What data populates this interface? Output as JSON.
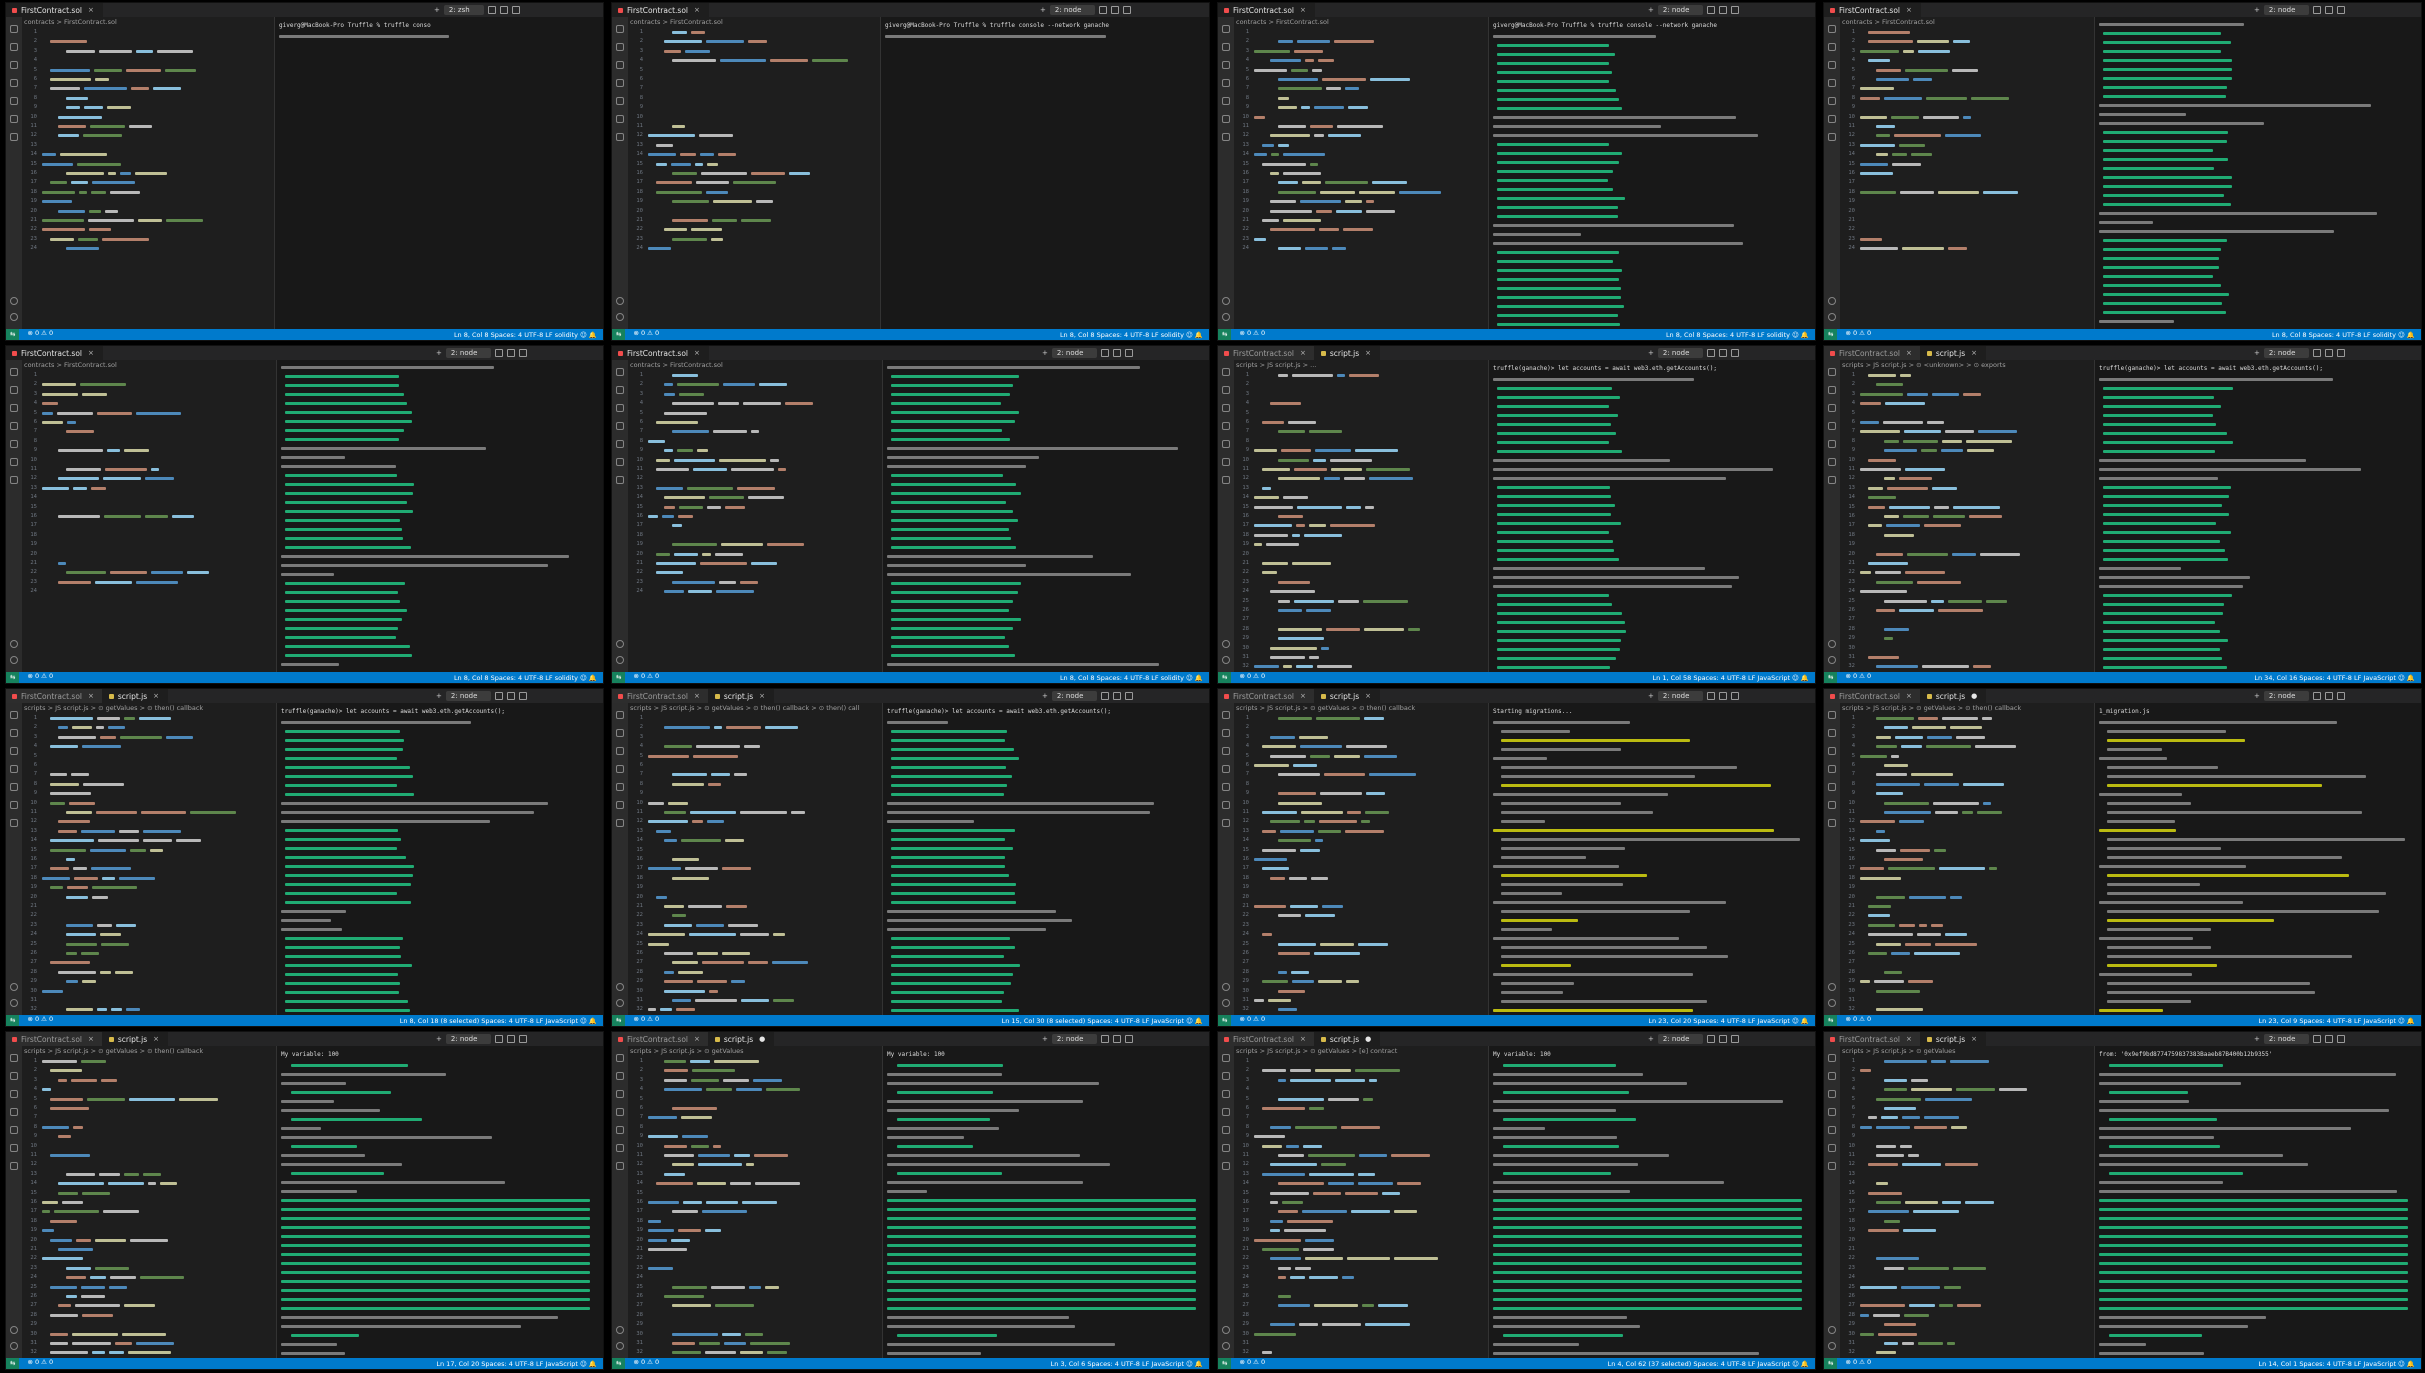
{
  "screen": {
    "background": "#000000"
  },
  "colors": {
    "editor_bg": "#1e1e1e",
    "terminal_bg": "#181818",
    "statusbar": "#007acc",
    "accent_green": "#16825d",
    "code_keyword": "#569cd6",
    "code_function": "#dcdcaa",
    "code_string": "#ce9178",
    "code_comment": "#6a9955",
    "code_ident": "#9cdcfe",
    "terminal_hex": "#23d18b",
    "terminal_text": "#cccccc"
  },
  "panels": [
    {
      "tabs": [
        {
          "label": "FirstContract.sol",
          "type": "sol",
          "active": true,
          "dirty": false
        }
      ],
      "breadcrumb": "contracts > FirstContract.sol",
      "terminal_select": "2: zsh",
      "terminal_head": "giverg@MacBook-Pro Truffle % truffle conso",
      "status_left": "⊗ 0 ⚠ 0",
      "status_right": "Ln 8, Col 8   Spaces: 4   UTF-8   LF   solidity   ☺  🔔",
      "terminal_kind": "short",
      "code_lines": 24
    },
    {
      "tabs": [
        {
          "label": "FirstContract.sol",
          "type": "sol",
          "active": true,
          "dirty": false
        }
      ],
      "breadcrumb": "contracts > FirstContract.sol",
      "terminal_select": "2: node",
      "terminal_head": "giverg@MacBook-Pro Truffle % truffle console --network ganache",
      "status_left": "⊗ 0 ⚠ 0",
      "status_right": "Ln 8, Col 8   Spaces: 4   UTF-8   LF   solidity   ☺  🔔",
      "terminal_kind": "short",
      "code_lines": 24
    },
    {
      "tabs": [
        {
          "label": "FirstContract.sol",
          "type": "sol",
          "active": true,
          "dirty": false
        }
      ],
      "breadcrumb": "contracts > FirstContract.sol",
      "terminal_select": "2: node",
      "terminal_head": "giverg@MacBook-Pro Truffle % truffle console --network ganache",
      "status_left": "⊗ 0 ⚠ 0",
      "status_right": "Ln 8, Col 8   Spaces: 4   UTF-8   LF   solidity   ☺  🔔",
      "terminal_kind": "hex",
      "code_lines": 24
    },
    {
      "tabs": [
        {
          "label": "FirstContract.sol",
          "type": "sol",
          "active": true,
          "dirty": false
        }
      ],
      "breadcrumb": "contracts > FirstContract.sol",
      "terminal_select": "2: node",
      "terminal_head": "",
      "status_left": "⊗ 0 ⚠ 0",
      "status_right": "Ln 8, Col 8   Spaces: 4   UTF-8   LF   solidity   ☺  🔔",
      "terminal_kind": "hex",
      "code_lines": 24
    },
    {
      "tabs": [
        {
          "label": "FirstContract.sol",
          "type": "sol",
          "active": true,
          "dirty": false
        }
      ],
      "breadcrumb": "contracts > FirstContract.sol",
      "terminal_select": "2: node",
      "terminal_head": "",
      "status_left": "⊗ 0 ⚠ 0",
      "status_right": "Ln 8, Col 8   Spaces: 4   UTF-8   LF   solidity   ☺  🔔",
      "terminal_kind": "hex",
      "code_lines": 24
    },
    {
      "tabs": [
        {
          "label": "FirstContract.sol",
          "type": "sol",
          "active": true,
          "dirty": false
        }
      ],
      "breadcrumb": "contracts > FirstContract.sol",
      "terminal_select": "2: node",
      "terminal_head": "",
      "status_left": "⊗ 0 ⚠ 0",
      "status_right": "Ln 8, Col 8   Spaces: 4   UTF-8   LF   solidity   ☺  🔔",
      "terminal_kind": "hex",
      "code_lines": 24
    },
    {
      "tabs": [
        {
          "label": "FirstContract.sol",
          "type": "sol",
          "active": false,
          "dirty": false
        },
        {
          "label": "script.js",
          "type": "js",
          "active": true,
          "dirty": false
        }
      ],
      "breadcrumb": "scripts > JS script.js > ...",
      "terminal_select": "2: node",
      "terminal_head": "truffle(ganache)> let accounts = await web3.eth.getAccounts();",
      "status_left": "⊗ 0 ⚠ 0",
      "status_right": "Ln 1, Col 58   Spaces: 4   UTF-8   LF   JavaScript   ☺  🔔",
      "terminal_kind": "hex",
      "code_lines": 34
    },
    {
      "tabs": [
        {
          "label": "FirstContract.sol",
          "type": "sol",
          "active": false,
          "dirty": false
        },
        {
          "label": "script.js",
          "type": "js",
          "active": true,
          "dirty": false
        }
      ],
      "breadcrumb": "scripts > JS script.js > ⊙ <unknown> > ⊙ exports",
      "terminal_select": "2: node",
      "terminal_head": "truffle(ganache)> let accounts = await web3.eth.getAccounts();",
      "status_left": "⊗ 0 ⚠ 0",
      "status_right": "Ln 34, Col 16   Spaces: 4   UTF-8   LF   JavaScript   ☺  🔔",
      "terminal_kind": "hex",
      "code_lines": 34
    },
    {
      "tabs": [
        {
          "label": "FirstContract.sol",
          "type": "sol",
          "active": false,
          "dirty": false
        },
        {
          "label": "script.js",
          "type": "js",
          "active": true,
          "dirty": false
        }
      ],
      "breadcrumb": "scripts > JS script.js > ⊙ getValues > ⊙ then() callback",
      "terminal_select": "2: node",
      "terminal_head": "truffle(ganache)> let accounts = await web3.eth.getAccounts();",
      "status_left": "⊗ 0 ⚠ 0",
      "status_right": "Ln 8, Col 18 (8 selected)   Spaces: 4   UTF-8   LF   JavaScript   ☺  🔔",
      "terminal_kind": "hex",
      "code_lines": 34
    },
    {
      "tabs": [
        {
          "label": "FirstContract.sol",
          "type": "sol",
          "active": false,
          "dirty": false
        },
        {
          "label": "script.js",
          "type": "js",
          "active": true,
          "dirty": false
        }
      ],
      "breadcrumb": "scripts > JS script.js > ⊙ getValues > ⊙ then() callback > ⊙ then() callback",
      "terminal_select": "2: node",
      "terminal_head": "truffle(ganache)> let accounts = await web3.eth.getAccounts();",
      "status_left": "⊗ 0 ⚠ 0",
      "status_right": "Ln 15, Col 30 (8 selected)   Spaces: 4   UTF-8   LF   JavaScript   ☺  🔔",
      "terminal_kind": "hex",
      "code_lines": 34
    },
    {
      "tabs": [
        {
          "label": "FirstContract.sol",
          "type": "sol",
          "active": false,
          "dirty": false
        },
        {
          "label": "script.js",
          "type": "js",
          "active": true,
          "dirty": false
        }
      ],
      "breadcrumb": "scripts > JS script.js > ⊙ getValues > ⊙ then() callback",
      "terminal_select": "2: node",
      "terminal_head": "Starting migrations...",
      "status_left": "⊗ 0 ⚠ 0",
      "status_right": "Ln 23, Col 20   Spaces: 4   UTF-8   LF   JavaScript   ☺  🔔",
      "terminal_kind": "migrate",
      "code_lines": 34
    },
    {
      "tabs": [
        {
          "label": "FirstContract.sol",
          "type": "sol",
          "active": false,
          "dirty": false
        },
        {
          "label": "script.js",
          "type": "js",
          "active": true,
          "dirty": true
        }
      ],
      "breadcrumb": "scripts > JS script.js > ⊙ getValues > ⊙ then() callback",
      "terminal_select": "2: node",
      "terminal_head": "1_migration.js",
      "status_left": "⊗ 0 ⚠ 0",
      "status_right": "Ln 23, Col 9   Spaces: 4   UTF-8   LF   JavaScript   ☺  🔔",
      "terminal_kind": "migrate",
      "code_lines": 34
    },
    {
      "tabs": [
        {
          "label": "FirstContract.sol",
          "type": "sol",
          "active": false,
          "dirty": false
        },
        {
          "label": "script.js",
          "type": "js",
          "active": true,
          "dirty": false
        }
      ],
      "breadcrumb": "scripts > JS script.js > ⊙ getValues > ⊙ then() callback",
      "terminal_select": "2: node",
      "terminal_head": "My variable: 100",
      "status_left": "⊗ 0 ⚠ 0",
      "status_right": "Ln 17, Col 20   Spaces: 4   UTF-8   LF   JavaScript   ☺  🔔",
      "terminal_kind": "receipt",
      "code_lines": 34
    },
    {
      "tabs": [
        {
          "label": "FirstContract.sol",
          "type": "sol",
          "active": false,
          "dirty": false
        },
        {
          "label": "script.js",
          "type": "js",
          "active": true,
          "dirty": true
        }
      ],
      "breadcrumb": "scripts > JS script.js > ⊙ getValues",
      "terminal_select": "2: node",
      "terminal_head": "My variable: 100",
      "status_left": "⊗ 0 ⚠ 0",
      "status_right": "Ln 3, Col 6   Spaces: 4   UTF-8   LF   JavaScript   ☺  🔔",
      "terminal_kind": "receipt",
      "code_lines": 34
    },
    {
      "tabs": [
        {
          "label": "FirstContract.sol",
          "type": "sol",
          "active": false,
          "dirty": false
        },
        {
          "label": "script.js",
          "type": "js",
          "active": true,
          "dirty": true
        }
      ],
      "breadcrumb": "scripts > JS script.js > ⊙ getValues > [e] contract",
      "terminal_select": "2: node",
      "terminal_head": "My variable: 100",
      "status_left": "⊗ 0 ⚠ 0",
      "status_right": "Ln 4, Col 62 (37 selected)   Spaces: 4   UTF-8   LF   JavaScript   ☺  🔔",
      "terminal_kind": "receipt",
      "code_lines": 34
    },
    {
      "tabs": [
        {
          "label": "FirstContract.sol",
          "type": "sol",
          "active": false,
          "dirty": false
        },
        {
          "label": "script.js",
          "type": "js",
          "active": true,
          "dirty": false
        }
      ],
      "breadcrumb": "scripts > JS script.js > ⊙ getValues",
      "terminal_select": "2: node",
      "terminal_head": "from: '0x9ef9bd8774759837383Baaeb87B400b12b9355'",
      "status_left": "⊗ 0 ⚠ 0",
      "status_right": "Ln 14, Col 1   Spaces: 4   UTF-8   LF   JavaScript   ☺  🔔",
      "terminal_kind": "receipt",
      "code_lines": 34
    }
  ]
}
